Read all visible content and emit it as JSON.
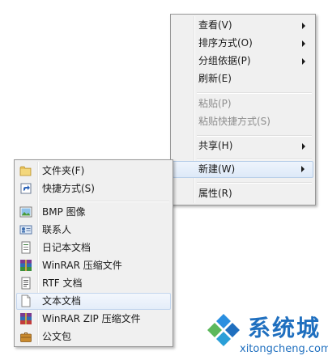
{
  "context_menu": {
    "items": [
      {
        "label": "查看(V)",
        "has_submenu": true
      },
      {
        "label": "排序方式(O)",
        "has_submenu": true
      },
      {
        "label": "分组依据(P)",
        "has_submenu": true
      },
      {
        "label": "刷新(E)"
      },
      {
        "label": "粘贴(P)",
        "disabled": true
      },
      {
        "label": "粘贴快捷方式(S)",
        "disabled": true
      },
      {
        "label": "共享(H)",
        "has_submenu": true
      },
      {
        "label": "新建(W)",
        "has_submenu": true,
        "highlighted": true
      },
      {
        "label": "属性(R)"
      }
    ]
  },
  "new_submenu": {
    "items": [
      {
        "label": "文件夹(F)",
        "icon": "folder-icon"
      },
      {
        "label": "快捷方式(S)",
        "icon": "shortcut-icon"
      },
      {
        "label": "BMP 图像",
        "icon": "bmp-image-icon"
      },
      {
        "label": "联系人",
        "icon": "contact-icon"
      },
      {
        "label": "日记本文档",
        "icon": "journal-document-icon"
      },
      {
        "label": "WinRAR 压缩文件",
        "icon": "winrar-archive-icon"
      },
      {
        "label": "RTF 文档",
        "icon": "rtf-document-icon"
      },
      {
        "label": "文本文档",
        "icon": "text-document-icon",
        "highlighted": true
      },
      {
        "label": "WinRAR ZIP 压缩文件",
        "icon": "winrar-zip-icon"
      },
      {
        "label": "公文包",
        "icon": "briefcase-icon"
      }
    ]
  },
  "watermark": {
    "brand": "系统城",
    "url": "xitongcheng.com"
  },
  "colors": {
    "menu_bg": "#f0f0f0",
    "highlight": "#dde9f8",
    "disabled_text": "#8d8d8d",
    "logo_blue": "#1f6fbf"
  }
}
